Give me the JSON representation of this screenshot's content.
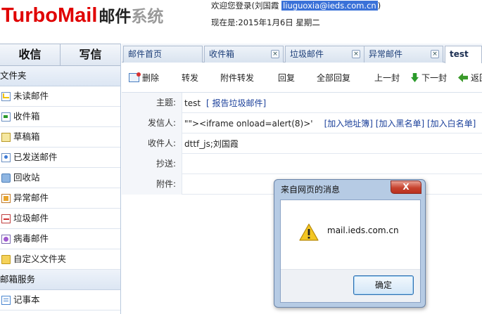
{
  "header": {
    "brand": "TurboMail",
    "brand_sub1": "邮件",
    "brand_sub2": "系统",
    "welcome_prefix": "欢迎您登录(刘国霞",
    "user_email": "liuguoxia@ieds.com.cn",
    "welcome_suffix": ")",
    "date_line": "现在是:2015年1月6日  星期二"
  },
  "sidebar": {
    "actions": [
      {
        "label": "收信"
      },
      {
        "label": "写信"
      }
    ],
    "folders_header": "文件夹",
    "folders": [
      {
        "label": "未读邮件",
        "icon": "unread-mail-icon"
      },
      {
        "label": "收件箱",
        "icon": "inbox-icon"
      },
      {
        "label": "草稿箱",
        "icon": "drafts-icon"
      },
      {
        "label": "已发送邮件",
        "icon": "sent-mail-icon"
      },
      {
        "label": "回收站",
        "icon": "recycle-bin-icon"
      },
      {
        "label": "异常邮件",
        "icon": "abnormal-mail-icon"
      },
      {
        "label": "垃圾邮件",
        "icon": "spam-icon"
      },
      {
        "label": "病毒邮件",
        "icon": "virus-mail-icon"
      },
      {
        "label": "自定义文件夹",
        "icon": "custom-folder-icon"
      }
    ],
    "services_header": "邮箱服务",
    "services": [
      {
        "label": "记事本",
        "icon": "notepad-icon"
      }
    ]
  },
  "tabs": [
    {
      "label": "邮件首页",
      "closable": false,
      "active": false
    },
    {
      "label": "收件箱",
      "closable": true,
      "active": false
    },
    {
      "label": "垃圾邮件",
      "closable": true,
      "active": false
    },
    {
      "label": "异常邮件",
      "closable": true,
      "active": false
    },
    {
      "label": "test",
      "closable": false,
      "active": true
    }
  ],
  "toolbar": {
    "delete": "删除",
    "forward": "转发",
    "forward_attachment": "附件转发",
    "reply": "回复",
    "reply_all": "全部回复",
    "prev": "上一封",
    "next": "下一封",
    "back": "返回"
  },
  "mail": {
    "subject_label": "主题:",
    "subject": "test",
    "report_spam": "[ 报告垃圾邮件]",
    "from_label": "发信人:",
    "from": "\"\"><iframe onload=alert(8)>'",
    "add_address_book": "[加入地址簿]",
    "add_blacklist": "[加入黑名单]",
    "add_whitelist": "[加入白名单]",
    "to_label": "收件人:",
    "to": "dttf_js;刘国霞",
    "cc_label": "抄送:",
    "cc": "",
    "attachment_label": "附件:",
    "attachment": ""
  },
  "dialog": {
    "title": "来自网页的消息",
    "message": "mail.ieds.com.cn",
    "ok": "确定",
    "close_symbol": "X"
  }
}
